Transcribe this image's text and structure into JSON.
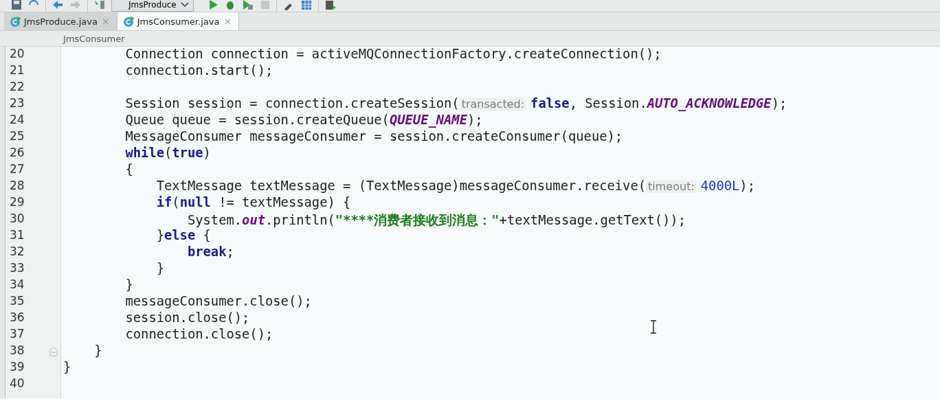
{
  "toolbar": {
    "run_config": "JmsProduce"
  },
  "tabs": [
    {
      "label": "JmsProduce.java",
      "selected": false,
      "close": "×"
    },
    {
      "label": "JmsConsumer.java",
      "selected": true,
      "close": "×"
    }
  ],
  "breadcrumb": "JmsConsumer",
  "lines": [
    {
      "number": "20",
      "tokens": [
        {
          "kind": "plain",
          "text": "        Connection connection = activeMQConnectionFactory.createConnection();"
        }
      ]
    },
    {
      "number": "21",
      "tokens": [
        {
          "kind": "plain",
          "text": "        connection.start();"
        }
      ]
    },
    {
      "number": "22"
    },
    {
      "number": "23",
      "tokens": [
        {
          "kind": "plain",
          "text": "        Session session = connection.createSession("
        },
        {
          "kind": "hint",
          "text": "transacted:"
        },
        {
          "kind": "keyword",
          "text": "false"
        },
        {
          "kind": "plain",
          "text": ", Session."
        },
        {
          "kind": "constant",
          "text": "AUTO_ACKNOWLEDGE"
        },
        {
          "kind": "plain",
          "text": ");"
        }
      ]
    },
    {
      "number": "24",
      "tokens": [
        {
          "kind": "plain",
          "text": "        Queue queue = session.createQueue("
        },
        {
          "kind": "constant",
          "text": "QUEUE_NAME"
        },
        {
          "kind": "plain",
          "text": ");"
        }
      ]
    },
    {
      "number": "25",
      "tokens": [
        {
          "kind": "plain",
          "text": "        MessageConsumer messageConsumer = session.createConsumer(queue);"
        }
      ]
    },
    {
      "number": "26",
      "tokens": [
        {
          "kind": "keyword",
          "text": "        while"
        },
        {
          "kind": "plain",
          "text": "("
        },
        {
          "kind": "keyword",
          "text": "true"
        },
        {
          "kind": "plain",
          "text": ")"
        }
      ]
    },
    {
      "number": "27",
      "tokens": [
        {
          "kind": "plain",
          "text": "        {"
        }
      ]
    },
    {
      "number": "28",
      "tokens": [
        {
          "kind": "plain",
          "text": "            TextMessage textMessage = (TextMessage)messageConsumer.receive("
        },
        {
          "kind": "hint",
          "text": "timeout:"
        },
        {
          "kind": "number",
          "text": "4000L"
        },
        {
          "kind": "plain",
          "text": ");"
        }
      ]
    },
    {
      "number": "29",
      "tokens": [
        {
          "kind": "keyword",
          "text": "            if"
        },
        {
          "kind": "plain",
          "text": "("
        },
        {
          "kind": "keyword",
          "text": "null"
        },
        {
          "kind": "plain",
          "text": " != textMessage) {"
        }
      ]
    },
    {
      "number": "30",
      "tokens": [
        {
          "kind": "plain",
          "text": "                System."
        },
        {
          "kind": "constant",
          "text": "out"
        },
        {
          "kind": "plain",
          "text": ".println("
        },
        {
          "kind": "string",
          "text": "\"****消费者接收到消息：\""
        },
        {
          "kind": "plain",
          "text": "+textMessage.getText());"
        }
      ]
    },
    {
      "number": "31",
      "tokens": [
        {
          "kind": "plain",
          "text": "            }"
        },
        {
          "kind": "keyword",
          "text": "else"
        },
        {
          "kind": "plain",
          "text": " {"
        }
      ]
    },
    {
      "number": "32",
      "tokens": [
        {
          "kind": "keyword",
          "text": "                break"
        },
        {
          "kind": "plain",
          "text": ";"
        }
      ]
    },
    {
      "number": "33",
      "tokens": [
        {
          "kind": "plain",
          "text": "            }"
        }
      ]
    },
    {
      "number": "34",
      "tokens": [
        {
          "kind": "plain",
          "text": "        }"
        }
      ]
    },
    {
      "number": "35",
      "tokens": [
        {
          "kind": "plain",
          "text": "        messageConsumer.close();"
        }
      ]
    },
    {
      "number": "36",
      "tokens": [
        {
          "kind": "plain",
          "text": "        session.close();"
        }
      ]
    },
    {
      "number": "37",
      "tokens": [
        {
          "kind": "plain",
          "text": "        connection.close();"
        }
      ]
    },
    {
      "number": "38",
      "fold": true,
      "tokens": [
        {
          "kind": "plain",
          "text": "    }"
        }
      ]
    },
    {
      "number": "39",
      "tokens": [
        {
          "kind": "plain",
          "text": "}"
        }
      ]
    },
    {
      "number": "40"
    }
  ]
}
